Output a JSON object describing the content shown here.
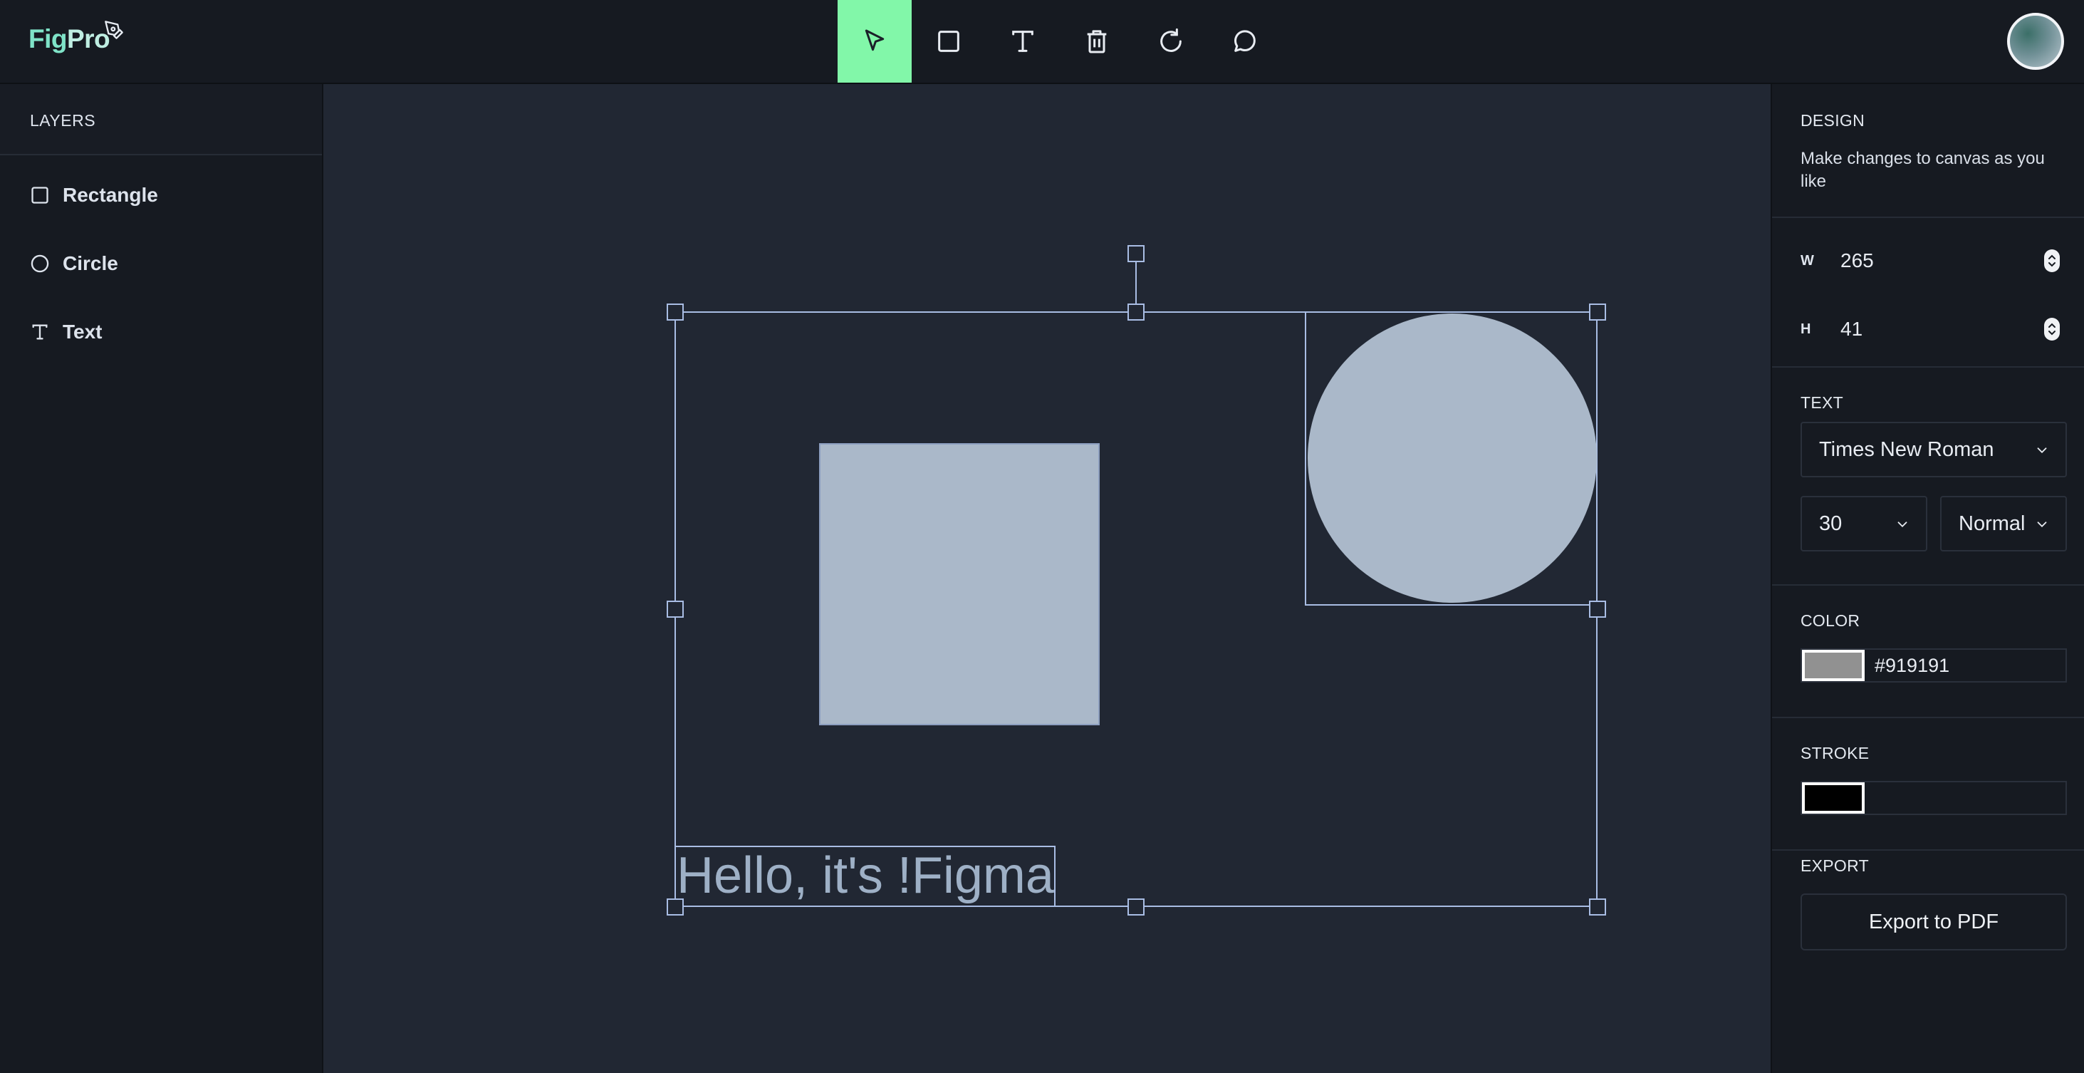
{
  "app": {
    "logo_fig": "Fig",
    "logo_pro": "Pro"
  },
  "toolbar": {
    "tools": [
      {
        "icon": "cursor-icon",
        "active": true
      },
      {
        "icon": "rectangle-icon",
        "active": false
      },
      {
        "icon": "text-icon",
        "active": false
      },
      {
        "icon": "trash-icon",
        "active": false
      },
      {
        "icon": "reset-icon",
        "active": false
      },
      {
        "icon": "comment-icon",
        "active": false
      }
    ],
    "active_color": "#82f7a9"
  },
  "layers": {
    "title": "LAYERS",
    "items": [
      {
        "label": "Rectangle",
        "icon": "square-icon"
      },
      {
        "label": "Circle",
        "icon": "circle-icon"
      },
      {
        "label": "Text",
        "icon": "text-icon"
      }
    ]
  },
  "canvas": {
    "text_content": "Hello, it's !Figma",
    "shape_fill": "#aab8c9",
    "selection_color": "#a9bde4"
  },
  "design": {
    "title": "DESIGN",
    "description": "Make changes to canvas as you like",
    "width_label": "W",
    "width_value": "265",
    "height_label": "H",
    "height_value": "41"
  },
  "text_section": {
    "title": "TEXT",
    "font_family": "Times New Roman",
    "font_size": "30",
    "font_weight": "Normal"
  },
  "color_section": {
    "title": "COLOR",
    "value": "#919191"
  },
  "stroke_section": {
    "title": "STROKE",
    "value": "#000000"
  },
  "export_section": {
    "title": "EXPORT",
    "button_label": "Export to PDF"
  }
}
